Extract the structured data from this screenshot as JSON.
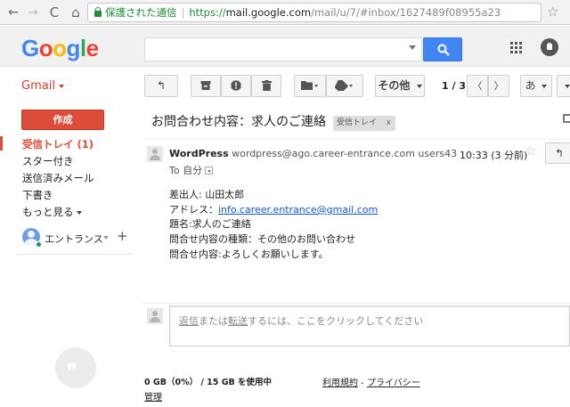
{
  "browser": {
    "back": "←",
    "forward": "→",
    "reload": "C",
    "home": "⌂",
    "secure_label": "保護された通信",
    "url_scheme": "https://",
    "url_host": "mail.google.com",
    "url_path": "/mail/u/7/#inbox/1627489f08955a23",
    "star": "☆"
  },
  "header": {
    "logo_letters": [
      "G",
      "o",
      "o",
      "g",
      "l",
      "e"
    ],
    "logo_colors": [
      "#4285f4",
      "#ea4335",
      "#fbbc05",
      "#4285f4",
      "#34a853",
      "#ea4335"
    ],
    "search_value": ""
  },
  "toolbar": {
    "app_label": "Gmail",
    "back_button": "↰",
    "more_label": "その他",
    "count": "1 / 3",
    "prev": "〈",
    "next": "〉",
    "input_tool": "あ"
  },
  "sidebar": {
    "compose": "作成",
    "items": [
      {
        "label": "受信トレイ (1)",
        "active": true
      },
      {
        "label": "スター付き"
      },
      {
        "label": "送信済みメール"
      },
      {
        "label": "下書き"
      },
      {
        "label": "もっと見る"
      }
    ],
    "hangouts_user": "エントランス",
    "add_contact": "+",
    "hangouts_mark": "❞"
  },
  "conversation": {
    "subject": "お問合わせ内容：求人のご連絡",
    "label": "受信トレイ",
    "label_remove": "x",
    "message": {
      "sender_name": "WordPress",
      "sender_email": "wordpress@ago.career-entrance.com",
      "via": "users43",
      "time": "10:33 (3 分前)",
      "star": "☆",
      "reply": "↰",
      "to_prefix": "To",
      "to_value": "自分",
      "body": {
        "line1": "差出人: 山田太郎",
        "line2_prefix": "アドレス：",
        "line2_link": "info.career.entrance@gmail.com",
        "line3": "題名:求人のご連絡",
        "line4": "問合せ内容の種類：その他のお問い合わせ",
        "line5": "問合せ内容:よろしくお願いします。"
      }
    },
    "reply_box": {
      "reply_word": "返信",
      "or_word": "または",
      "forward_word": "転送",
      "rest": "するには、ここをクリックしてください"
    }
  },
  "footer": {
    "storage": "0 GB（0%） / 15 GB を使用中",
    "manage": "管理",
    "terms": "利用規約",
    "separator": " - ",
    "privacy": "プライバシー"
  },
  "colors": {
    "accent_red": "#dd4b39",
    "search_blue": "#4285f4",
    "link_blue": "#1155cc",
    "secure_green": "#1f8e3a"
  }
}
